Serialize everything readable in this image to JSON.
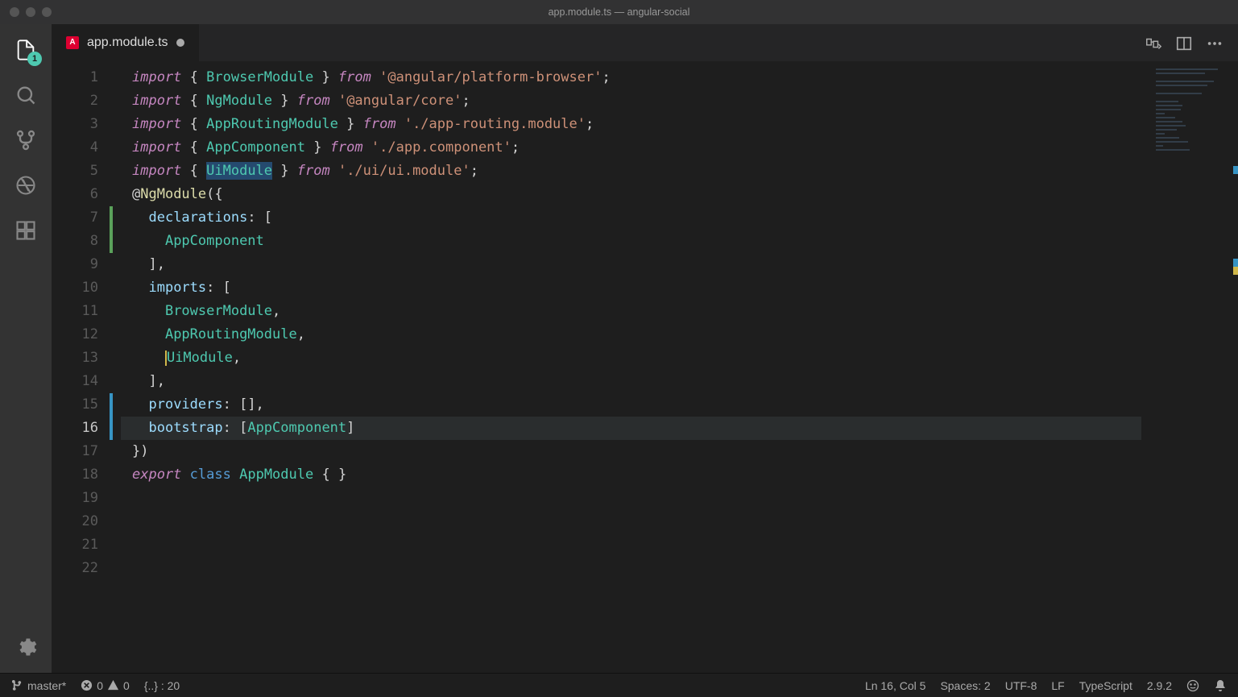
{
  "window": {
    "title": "app.module.ts — angular-social"
  },
  "activity": {
    "explorer_badge": "1"
  },
  "tab": {
    "filename": "app.module.ts",
    "filetype_initial": "A"
  },
  "code": {
    "lines": [
      [
        {
          "c": "k",
          "t": "import"
        },
        {
          "c": "p",
          "t": " { "
        },
        {
          "c": "t",
          "t": "BrowserModule"
        },
        {
          "c": "p",
          "t": " } "
        },
        {
          "c": "k",
          "t": "from"
        },
        {
          "c": "p",
          "t": " "
        },
        {
          "c": "s",
          "t": "'@angular/platform-browser'"
        },
        {
          "c": "p",
          "t": ";"
        }
      ],
      [
        {
          "c": "k",
          "t": "import"
        },
        {
          "c": "p",
          "t": " { "
        },
        {
          "c": "t",
          "t": "NgModule"
        },
        {
          "c": "p",
          "t": " } "
        },
        {
          "c": "k",
          "t": "from"
        },
        {
          "c": "p",
          "t": " "
        },
        {
          "c": "s",
          "t": "'@angular/core'"
        },
        {
          "c": "p",
          "t": ";"
        }
      ],
      [],
      [
        {
          "c": "k",
          "t": "import"
        },
        {
          "c": "p",
          "t": " { "
        },
        {
          "c": "t",
          "t": "AppRoutingModule"
        },
        {
          "c": "p",
          "t": " } "
        },
        {
          "c": "k",
          "t": "from"
        },
        {
          "c": "p",
          "t": " "
        },
        {
          "c": "s",
          "t": "'./app-routing.module'"
        },
        {
          "c": "p",
          "t": ";"
        }
      ],
      [
        {
          "c": "k",
          "t": "import"
        },
        {
          "c": "p",
          "t": " { "
        },
        {
          "c": "t",
          "t": "AppComponent"
        },
        {
          "c": "p",
          "t": " } "
        },
        {
          "c": "k",
          "t": "from"
        },
        {
          "c": "p",
          "t": " "
        },
        {
          "c": "s",
          "t": "'./app.component'"
        },
        {
          "c": "p",
          "t": ";"
        }
      ],
      [],
      [
        {
          "c": "k",
          "t": "import"
        },
        {
          "c": "p",
          "t": " { "
        },
        {
          "c": "t sel",
          "t": "UiModule"
        },
        {
          "c": "p",
          "t": " } "
        },
        {
          "c": "k",
          "t": "from"
        },
        {
          "c": "p",
          "t": " "
        },
        {
          "c": "s",
          "t": "'./ui/ui.module'"
        },
        {
          "c": "p",
          "t": ";"
        }
      ],
      [],
      [
        {
          "c": "p",
          "t": "@"
        },
        {
          "c": "fn",
          "t": "NgModule"
        },
        {
          "c": "p",
          "t": "({"
        }
      ],
      [
        {
          "c": "p",
          "t": "  "
        },
        {
          "c": "c",
          "t": "declarations"
        },
        {
          "c": "p",
          "t": ": ["
        }
      ],
      [
        {
          "c": "p",
          "t": "    "
        },
        {
          "c": "t",
          "t": "AppComponent"
        }
      ],
      [
        {
          "c": "p",
          "t": "  ],"
        }
      ],
      [
        {
          "c": "p",
          "t": "  "
        },
        {
          "c": "c",
          "t": "imports"
        },
        {
          "c": "p",
          "t": ": ["
        }
      ],
      [
        {
          "c": "p",
          "t": "    "
        },
        {
          "c": "t",
          "t": "BrowserModule"
        },
        {
          "c": "p",
          "t": ","
        }
      ],
      [
        {
          "c": "p",
          "t": "    "
        },
        {
          "c": "t",
          "t": "AppRoutingModule"
        },
        {
          "c": "p",
          "t": ","
        }
      ],
      [
        {
          "c": "p",
          "t": "    "
        },
        {
          "c": "cursor",
          "t": ""
        },
        {
          "c": "t",
          "t": "UiModule"
        },
        {
          "c": "p",
          "t": ","
        }
      ],
      [
        {
          "c": "p",
          "t": "  ],"
        }
      ],
      [
        {
          "c": "p",
          "t": "  "
        },
        {
          "c": "c",
          "t": "providers"
        },
        {
          "c": "p",
          "t": ": [],"
        }
      ],
      [
        {
          "c": "p",
          "t": "  "
        },
        {
          "c": "c",
          "t": "bootstrap"
        },
        {
          "c": "p",
          "t": ": ["
        },
        {
          "c": "t",
          "t": "AppComponent"
        },
        {
          "c": "p",
          "t": "]"
        }
      ],
      [
        {
          "c": "p",
          "t": "})"
        }
      ],
      [
        {
          "c": "k",
          "t": "export"
        },
        {
          "c": "p",
          "t": " "
        },
        {
          "c": "k2",
          "t": "class"
        },
        {
          "c": "p",
          "t": " "
        },
        {
          "c": "t",
          "t": "AppModule"
        },
        {
          "c": "p",
          "t": " { }"
        }
      ],
      []
    ],
    "current_line": 16,
    "change_markers": [
      {
        "from": 7,
        "to": 8,
        "type": "add"
      },
      {
        "from": 15,
        "to": 16,
        "type": "mod"
      }
    ]
  },
  "status": {
    "branch": "master*",
    "errors": "0",
    "warnings": "0",
    "bracket": "{..} : 20",
    "position": "Ln 16, Col 5",
    "spaces": "Spaces: 2",
    "encoding": "UTF-8",
    "eol": "LF",
    "language": "TypeScript",
    "ts_version": "2.9.2"
  }
}
